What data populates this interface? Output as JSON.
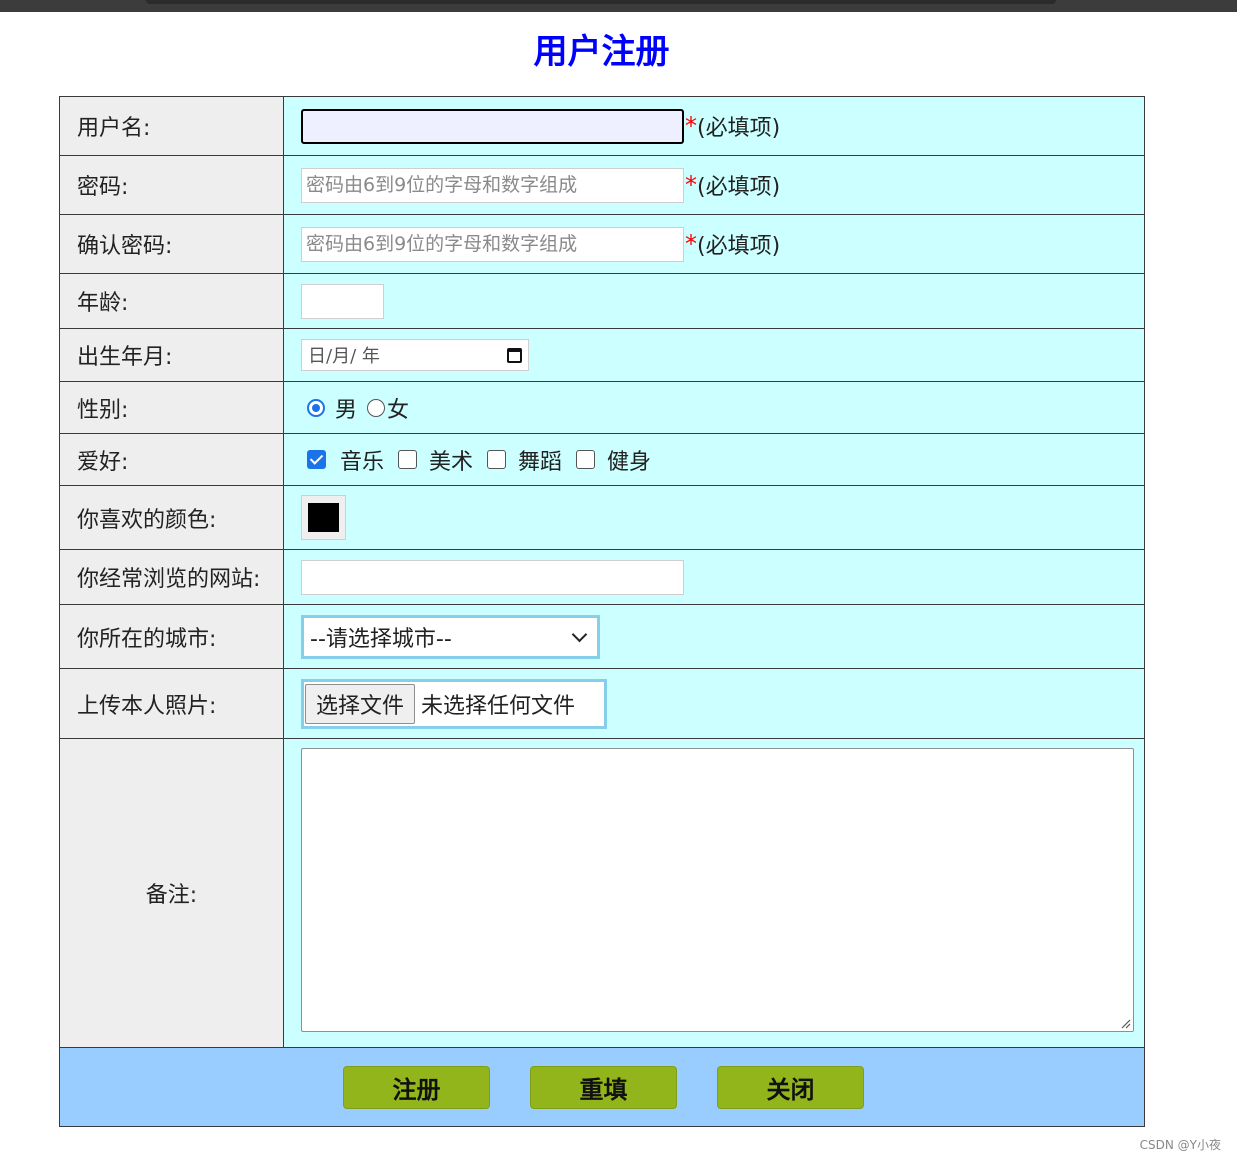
{
  "page": {
    "title": "用户注册"
  },
  "required_hint": "(必填项)",
  "fields": {
    "username": {
      "label": "用户名:",
      "value": ""
    },
    "password": {
      "label": "密码:",
      "placeholder": "密码由6到9位的字母和数字组成"
    },
    "confirm_password": {
      "label": "确认密码:",
      "placeholder": "密码由6到9位的字母和数字组成"
    },
    "age": {
      "label": "年龄:",
      "value": ""
    },
    "birth": {
      "label": "出生年月:",
      "display": "日/月/ 年"
    },
    "gender": {
      "label": "性别:",
      "options": [
        "男",
        "女"
      ],
      "selected": "男"
    },
    "hobbies": {
      "label": "爱好:",
      "options": [
        "音乐",
        "美术",
        "舞蹈",
        "健身"
      ],
      "checked": [
        "音乐"
      ]
    },
    "color": {
      "label": "你喜欢的颜色:",
      "value": "#000000"
    },
    "website": {
      "label": "你经常浏览的网站:",
      "value": ""
    },
    "city": {
      "label": "你所在的城市:",
      "selected": "--请选择城市--"
    },
    "photo": {
      "label": "上传本人照片:",
      "button": "选择文件",
      "status": "未选择任何文件"
    },
    "notes": {
      "label": "备注:",
      "value": ""
    }
  },
  "actions": {
    "register": "注册",
    "reset": "重填",
    "close": "关闭"
  },
  "watermark": "CSDN @Y小夜",
  "colors": {
    "title": "#0000ff",
    "label_bg": "#eeeeee",
    "value_bg": "#ccffff",
    "footer_bg": "#99ccff",
    "button_bg": "#92b51b",
    "required": "#ff0000"
  }
}
